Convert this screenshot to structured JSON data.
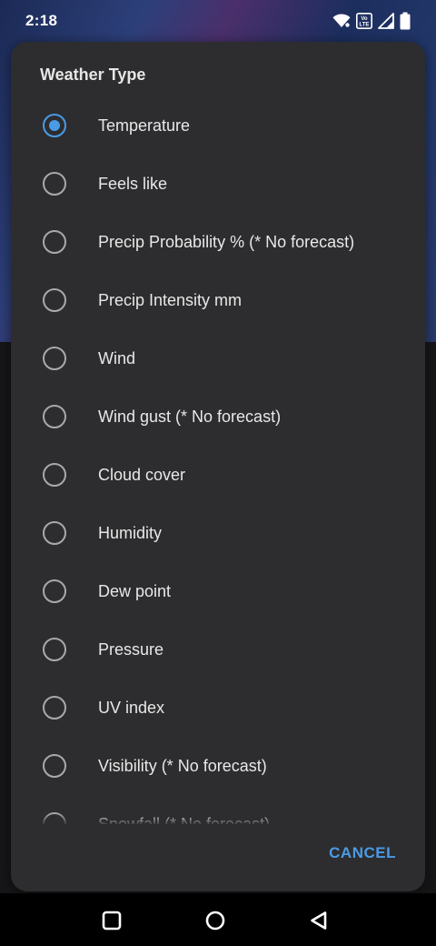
{
  "status_bar": {
    "time": "2:18",
    "volte_label": "Vo LTE",
    "icons": [
      "wifi-icon",
      "volte-icon",
      "signal-icon",
      "battery-icon"
    ]
  },
  "dialog": {
    "title": "Weather Type",
    "selected_index": 0,
    "options": [
      {
        "label": "Temperature",
        "selected": true
      },
      {
        "label": "Feels like",
        "selected": false
      },
      {
        "label": "Precip Probability % (* No forecast)",
        "selected": false
      },
      {
        "label": "Precip Intensity mm",
        "selected": false
      },
      {
        "label": "Wind",
        "selected": false
      },
      {
        "label": "Wind gust (* No forecast)",
        "selected": false
      },
      {
        "label": "Cloud cover",
        "selected": false
      },
      {
        "label": "Humidity",
        "selected": false
      },
      {
        "label": "Dew point",
        "selected": false
      },
      {
        "label": "Pressure",
        "selected": false
      },
      {
        "label": "UV index",
        "selected": false
      },
      {
        "label": "Visibility (* No forecast)",
        "selected": false
      },
      {
        "label": "Snowfall (* No forecast)",
        "selected": false
      }
    ],
    "cancel_label": "CANCEL"
  },
  "nav_bar": {
    "icons": [
      "recents-square-icon",
      "home-circle-icon",
      "back-triangle-icon"
    ]
  },
  "colors": {
    "accent": "#4a9be6",
    "dialog_bg": "#2d2d2f",
    "text": "#e8e8e8",
    "radio_unselected": "#a9a9ab"
  }
}
